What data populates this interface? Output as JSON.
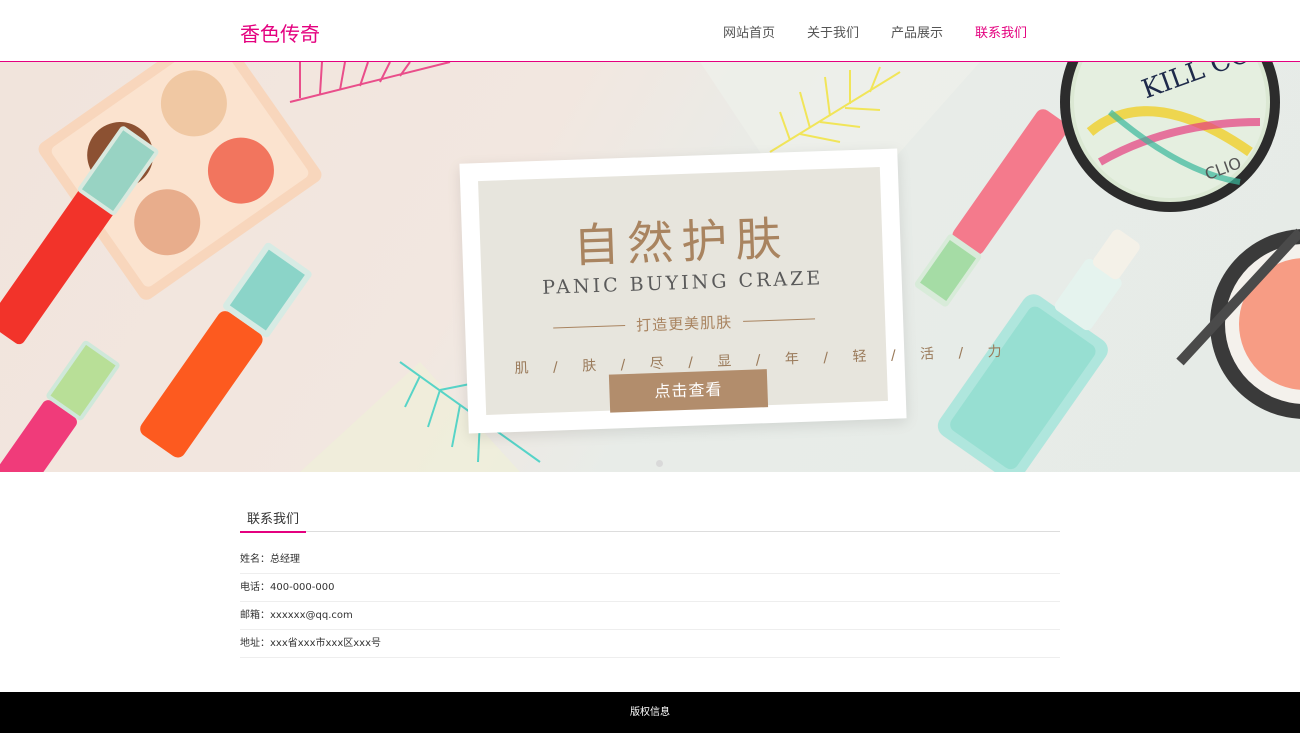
{
  "header": {
    "logo": "香色传奇",
    "nav": [
      {
        "label": "网站首页",
        "active": false
      },
      {
        "label": "关于我们",
        "active": false
      },
      {
        "label": "产品展示",
        "active": false
      },
      {
        "label": "联系我们",
        "active": true
      }
    ]
  },
  "banner": {
    "title": "自然护肤",
    "subtitle": "PANIC BUYING CRAZE",
    "slogan": "打造更美肌肤",
    "chars": "肌 / 肤 / 尽 / 显 / 年 / 轻 / 活 / 力",
    "button": "点击查看",
    "compact_brand": "CLIO",
    "compact_cover_text": "KILL COVER"
  },
  "contact": {
    "title": "联系我们",
    "rows": [
      {
        "label": "姓名：",
        "value": "总经理"
      },
      {
        "label": "电话：",
        "value": "400-000-000"
      },
      {
        "label": "邮箱：",
        "value": "xxxxxx@qq.com"
      },
      {
        "label": "地址：",
        "value": "xxx省xxx市xxx区xxx号"
      }
    ]
  },
  "footer": {
    "text": "版权信息"
  },
  "colors": {
    "accent": "#e4007f",
    "banner_text": "#a98460",
    "button": "#b28d6c",
    "footer_bg": "#000000"
  }
}
